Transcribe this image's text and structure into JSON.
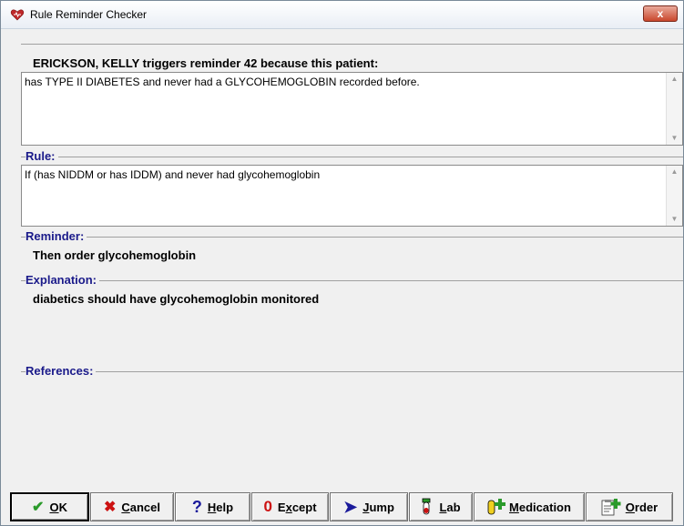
{
  "window": {
    "title": "Rule Reminder Checker",
    "close_label": "x"
  },
  "patient_header": "ERICKSON, KELLY triggers reminder 42 because this patient:",
  "patient_reason": "has TYPE II DIABETES and never had a GLYCOHEMOGLOBIN recorded before.",
  "rule": {
    "legend": "Rule:",
    "text": "If (has NIDDM or has IDDM) and never had glycohemoglobin"
  },
  "reminder": {
    "legend": "Reminder:",
    "text": "Then order glycohemoglobin"
  },
  "explanation": {
    "legend": "Explanation:",
    "text": "diabetics should have glycohemoglobin monitored"
  },
  "references": {
    "legend": "References:",
    "text": ""
  },
  "buttons": {
    "ok": {
      "mn": "O",
      "rest": "K"
    },
    "cancel": {
      "mn": "C",
      "rest": "ancel"
    },
    "help": {
      "mn": "H",
      "rest": "elp"
    },
    "except": {
      "pre": "E",
      "mn": "x",
      "rest": "cept"
    },
    "jump": {
      "mn": "J",
      "rest": "ump"
    },
    "lab": {
      "mn": "L",
      "rest": "ab"
    },
    "medication": {
      "mn": "M",
      "rest": "edication"
    },
    "order": {
      "mn": "O",
      "rest": "rder"
    }
  },
  "colors": {
    "legend": "#1a1a8a",
    "accent_green": "#2a9a2a",
    "accent_red": "#cc1111",
    "accent_blue": "#1a1a9a"
  },
  "icons": {
    "title": "heart-icon",
    "ok": "checkmark-icon",
    "cancel": "x-icon",
    "help": "question-icon",
    "except": "zero-icon",
    "jump": "arrow-icon",
    "lab": "test-tube-icon",
    "medication": "vial-plus-icon",
    "order": "clipboard-plus-icon"
  }
}
